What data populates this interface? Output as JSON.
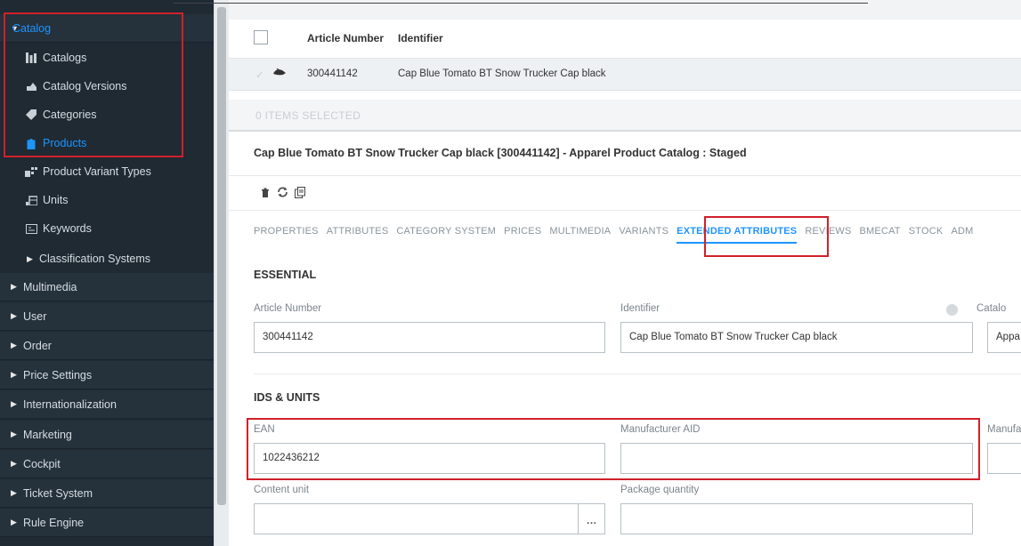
{
  "sidebar": {
    "catalog_label": "Catalog",
    "items": [
      {
        "label": "Catalogs",
        "icon": "catalogs-icon"
      },
      {
        "label": "Catalog Versions",
        "icon": "catalog-versions-icon"
      },
      {
        "label": "Categories",
        "icon": "tag-icon"
      },
      {
        "label": "Products",
        "icon": "product-icon"
      },
      {
        "label": "Product Variant Types",
        "icon": "variant-types-icon"
      },
      {
        "label": "Units",
        "icon": "units-icon"
      },
      {
        "label": "Keywords",
        "icon": "keywords-icon"
      },
      {
        "label": "Classification Systems",
        "icon": "expand-icon"
      }
    ],
    "groups": [
      "Multimedia",
      "User",
      "Order",
      "Price Settings",
      "Internationalization",
      "Marketing",
      "Cockpit",
      "Ticket System",
      "Rule Engine"
    ]
  },
  "grid": {
    "columns": [
      "Article Number",
      "Identifier"
    ],
    "row": {
      "article_number": "300441142",
      "identifier": "Cap Blue Tomato BT Snow Trucker Cap black"
    },
    "items_selected": "0 ITEMS SELECTED"
  },
  "editor": {
    "title": "Cap Blue Tomato BT Snow Trucker Cap black [300441142] - Apparel Product Catalog : Staged",
    "tabs": [
      "PROPERTIES",
      "ATTRIBUTES",
      "CATEGORY SYSTEM",
      "PRICES",
      "MULTIMEDIA",
      "VARIANTS",
      "EXTENDED ATTRIBUTES",
      "REVIEWS",
      "BMECAT",
      "STOCK",
      "ADM"
    ],
    "active_tab": "EXTENDED ATTRIBUTES",
    "essential": {
      "title": "ESSENTIAL",
      "article_number_label": "Article Number",
      "article_number_value": "300441142",
      "identifier_label": "Identifier",
      "identifier_value": "Cap Blue Tomato BT Snow Trucker Cap black",
      "catalog_label": "Catalo",
      "catalog_value": "Appa"
    },
    "ids_units": {
      "title": "IDS & UNITS",
      "ean_label": "EAN",
      "ean_value": "1022436212",
      "manufacturer_aid_label": "Manufacturer AID",
      "manufacturer_aid_value": "",
      "manufacturer_label": "Manufa",
      "content_unit_label": "Content unit",
      "content_unit_value": "",
      "content_unit_button": "…",
      "package_quantity_label": "Package quantity",
      "package_quantity_value": ""
    }
  },
  "colors": {
    "sidebar_bg": "#1f2a33",
    "accent": "#1e94ff",
    "highlight": "#d0202a"
  }
}
